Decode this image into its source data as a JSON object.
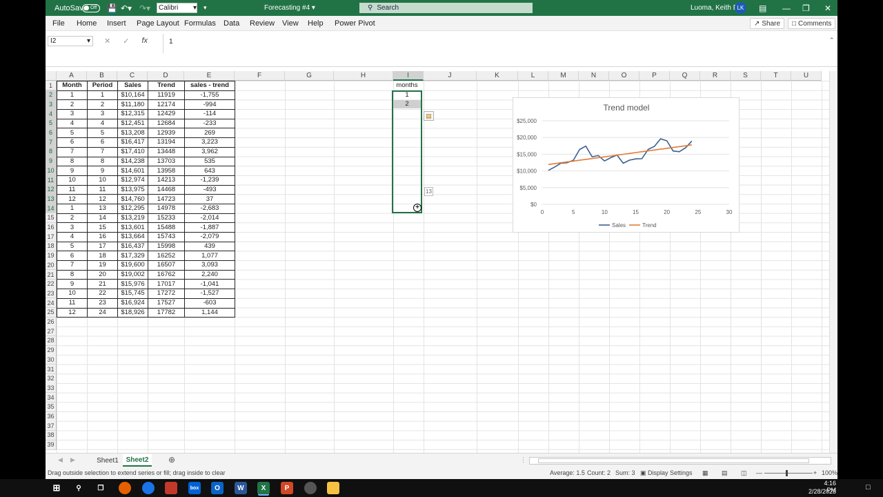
{
  "titlebar": {
    "autosave": "AutoSave",
    "toggle": "Off",
    "font": "Calibri",
    "doc_title": "Forecasting #4 ▾",
    "search": "Search",
    "user": "Luoma, Keith E.",
    "initials": "LK"
  },
  "menu": [
    "File",
    "Home",
    "Insert",
    "Page Layout",
    "Formulas",
    "Data",
    "Review",
    "View",
    "Help",
    "Power Pivot"
  ],
  "share": "Share",
  "comments": "Comments",
  "formula": {
    "namebox": "I2",
    "value": "1"
  },
  "columns": [
    "A",
    "B",
    "C",
    "D",
    "E",
    "F",
    "G",
    "H",
    "I",
    "J",
    "K",
    "L",
    "M",
    "N",
    "O",
    "P",
    "Q",
    "R",
    "S",
    "T",
    "U"
  ],
  "rows": [
    1,
    2,
    3,
    4,
    5,
    6,
    7,
    8,
    9,
    10,
    11,
    12,
    13,
    14,
    15,
    16,
    17,
    18,
    19,
    20,
    21,
    22,
    23,
    24,
    25,
    26,
    27,
    28,
    29,
    30,
    31,
    32,
    33,
    34,
    35,
    36,
    37,
    38,
    39
  ],
  "table": {
    "headers": [
      "Month",
      "Period",
      "Sales",
      "Trend",
      "sales - trend"
    ],
    "rows": [
      [
        "1",
        "1",
        "$10,164",
        "11919",
        "-1,755"
      ],
      [
        "2",
        "2",
        "$11,180",
        "12174",
        "-994"
      ],
      [
        "3",
        "3",
        "$12,315",
        "12429",
        "-114"
      ],
      [
        "4",
        "4",
        "$12,451",
        "12684",
        "-233"
      ],
      [
        "5",
        "5",
        "$13,208",
        "12939",
        "269"
      ],
      [
        "6",
        "6",
        "$16,417",
        "13194",
        "3,223"
      ],
      [
        "7",
        "7",
        "$17,410",
        "13448",
        "3,962"
      ],
      [
        "8",
        "8",
        "$14,238",
        "13703",
        "535"
      ],
      [
        "9",
        "9",
        "$14,601",
        "13958",
        "643"
      ],
      [
        "10",
        "10",
        "$12,974",
        "14213",
        "-1,239"
      ],
      [
        "11",
        "11",
        "$13,975",
        "14468",
        "-493"
      ],
      [
        "12",
        "12",
        "$14,760",
        "14723",
        "37"
      ],
      [
        "1",
        "13",
        "$12,295",
        "14978",
        "-2,683"
      ],
      [
        "2",
        "14",
        "$13,219",
        "15233",
        "-2,014"
      ],
      [
        "3",
        "15",
        "$13,601",
        "15488",
        "-1,887"
      ],
      [
        "4",
        "16",
        "$13,664",
        "15743",
        "-2,079"
      ],
      [
        "5",
        "17",
        "$16,437",
        "15998",
        "439"
      ],
      [
        "6",
        "18",
        "$17,329",
        "16252",
        "1,077"
      ],
      [
        "7",
        "19",
        "$19,600",
        "16507",
        "3,093"
      ],
      [
        "8",
        "20",
        "$19,002",
        "16762",
        "2,240"
      ],
      [
        "9",
        "21",
        "$15,976",
        "17017",
        "-1,041"
      ],
      [
        "10",
        "22",
        "$15,745",
        "17272",
        "-1,527"
      ],
      [
        "11",
        "23",
        "$16,924",
        "17527",
        "-603"
      ],
      [
        "12",
        "24",
        "$18,926",
        "17782",
        "1,144"
      ]
    ]
  },
  "icol": {
    "header": "months",
    "values": [
      "1",
      "2"
    ],
    "fill_tip": "13"
  },
  "chart_data": {
    "type": "line",
    "title": "Trend model",
    "x": [
      1,
      2,
      3,
      4,
      5,
      6,
      7,
      8,
      9,
      10,
      11,
      12,
      13,
      14,
      15,
      16,
      17,
      18,
      19,
      20,
      21,
      22,
      23,
      24
    ],
    "series": [
      {
        "name": "Sales",
        "color": "#3b5f8f",
        "values": [
          10164,
          11180,
          12315,
          12451,
          13208,
          16417,
          17410,
          14238,
          14601,
          12974,
          13975,
          14760,
          12295,
          13219,
          13601,
          13664,
          16437,
          17329,
          19600,
          19002,
          15976,
          15745,
          16924,
          18926
        ]
      },
      {
        "name": "Trend",
        "color": "#e07b39",
        "values": [
          11919,
          12174,
          12429,
          12684,
          12939,
          13194,
          13448,
          13703,
          13958,
          14213,
          14468,
          14723,
          14978,
          15233,
          15488,
          15743,
          15998,
          16252,
          16507,
          16762,
          17017,
          17272,
          17527,
          17782
        ]
      }
    ],
    "xlim": [
      0,
      30
    ],
    "ylim": [
      0,
      25000
    ],
    "xticks": [
      0,
      5,
      10,
      15,
      20,
      25,
      30
    ],
    "yticks": [
      0,
      5000,
      10000,
      15000,
      20000,
      25000
    ],
    "ytick_labels": [
      "$0",
      "$5,000",
      "$10,000",
      "$15,000",
      "$20,000",
      "$25,000"
    ],
    "grid": true,
    "legend": "bottom"
  },
  "sheets": [
    "Sheet1",
    "Sheet2"
  ],
  "status": {
    "message": "Drag outside selection to extend series or fill; drag inside to clear",
    "average": "Average: 1.5",
    "count": "Count: 2",
    "sum": "Sum: 3",
    "display": "Display Settings",
    "zoom": "100%"
  },
  "taskbar": {
    "time": "4:16 PM",
    "date": "2/28/2023"
  }
}
